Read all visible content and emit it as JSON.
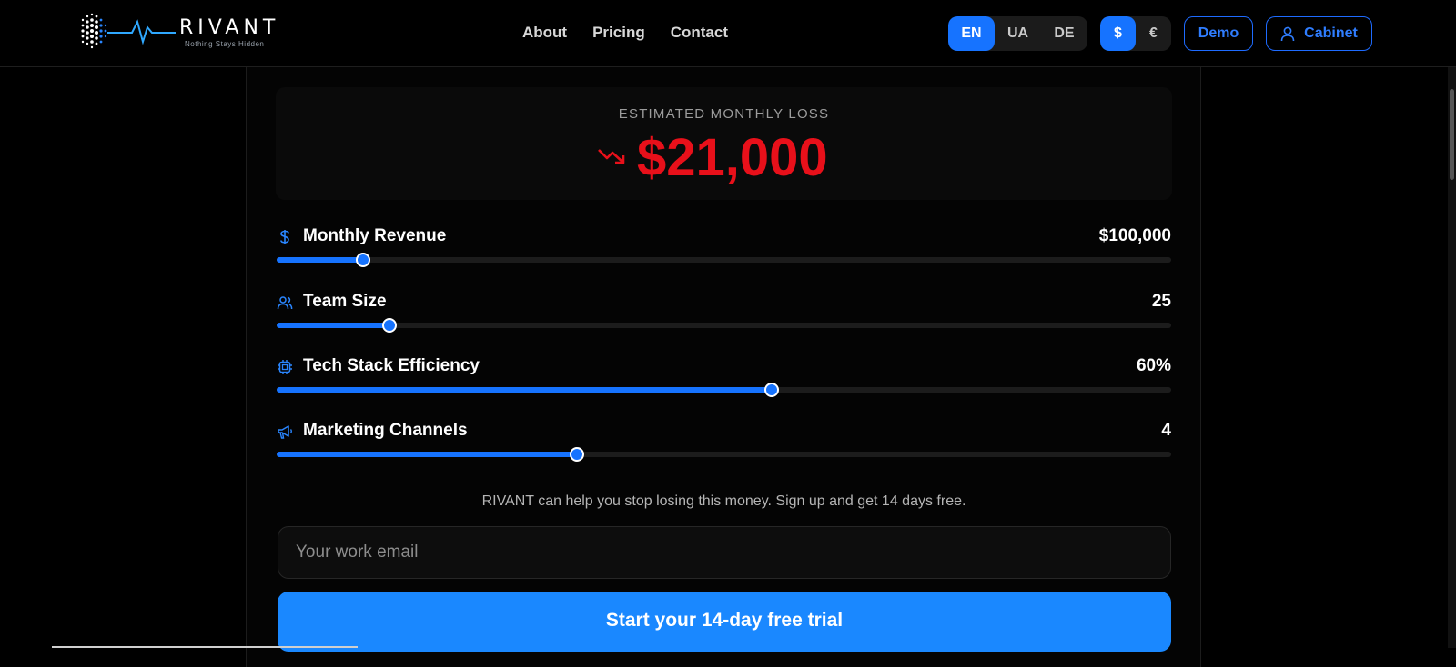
{
  "brand": {
    "name": "RIVANT",
    "tagline": "Nothing Stays Hidden"
  },
  "nav": {
    "items": [
      "About",
      "Pricing",
      "Contact"
    ]
  },
  "languages": {
    "options": [
      "EN",
      "UA",
      "DE"
    ],
    "selected": "EN"
  },
  "currency": {
    "options": [
      "$",
      "€"
    ],
    "selected": "$"
  },
  "header_buttons": {
    "demo": "Demo",
    "cabinet": "Cabinet"
  },
  "loss": {
    "label": "ESTIMATED MONTHLY LOSS",
    "value": "$21,000",
    "color": "#e8101a"
  },
  "sliders": [
    {
      "label": "Monthly Revenue",
      "value": "$100,000",
      "level": 0.097,
      "icon": "dollar-icon"
    },
    {
      "label": "Team Size",
      "value": "25",
      "level": 0.126,
      "icon": "users-icon"
    },
    {
      "label": "Tech Stack Efficiency",
      "value": "60%",
      "level": 0.553,
      "icon": "cpu-icon"
    },
    {
      "label": "Marketing Channels",
      "value": "4",
      "level": 0.336,
      "icon": "megaphone-icon"
    }
  ],
  "signup": {
    "help_text": "RIVANT can help you stop losing this money. Sign up and get 14 days free.",
    "email_placeholder": "Your work email",
    "cta_label": "Start your 14-day free trial"
  },
  "colors": {
    "accent": "#1673ff",
    "cta": "#1a88ff",
    "background": "#000000"
  }
}
